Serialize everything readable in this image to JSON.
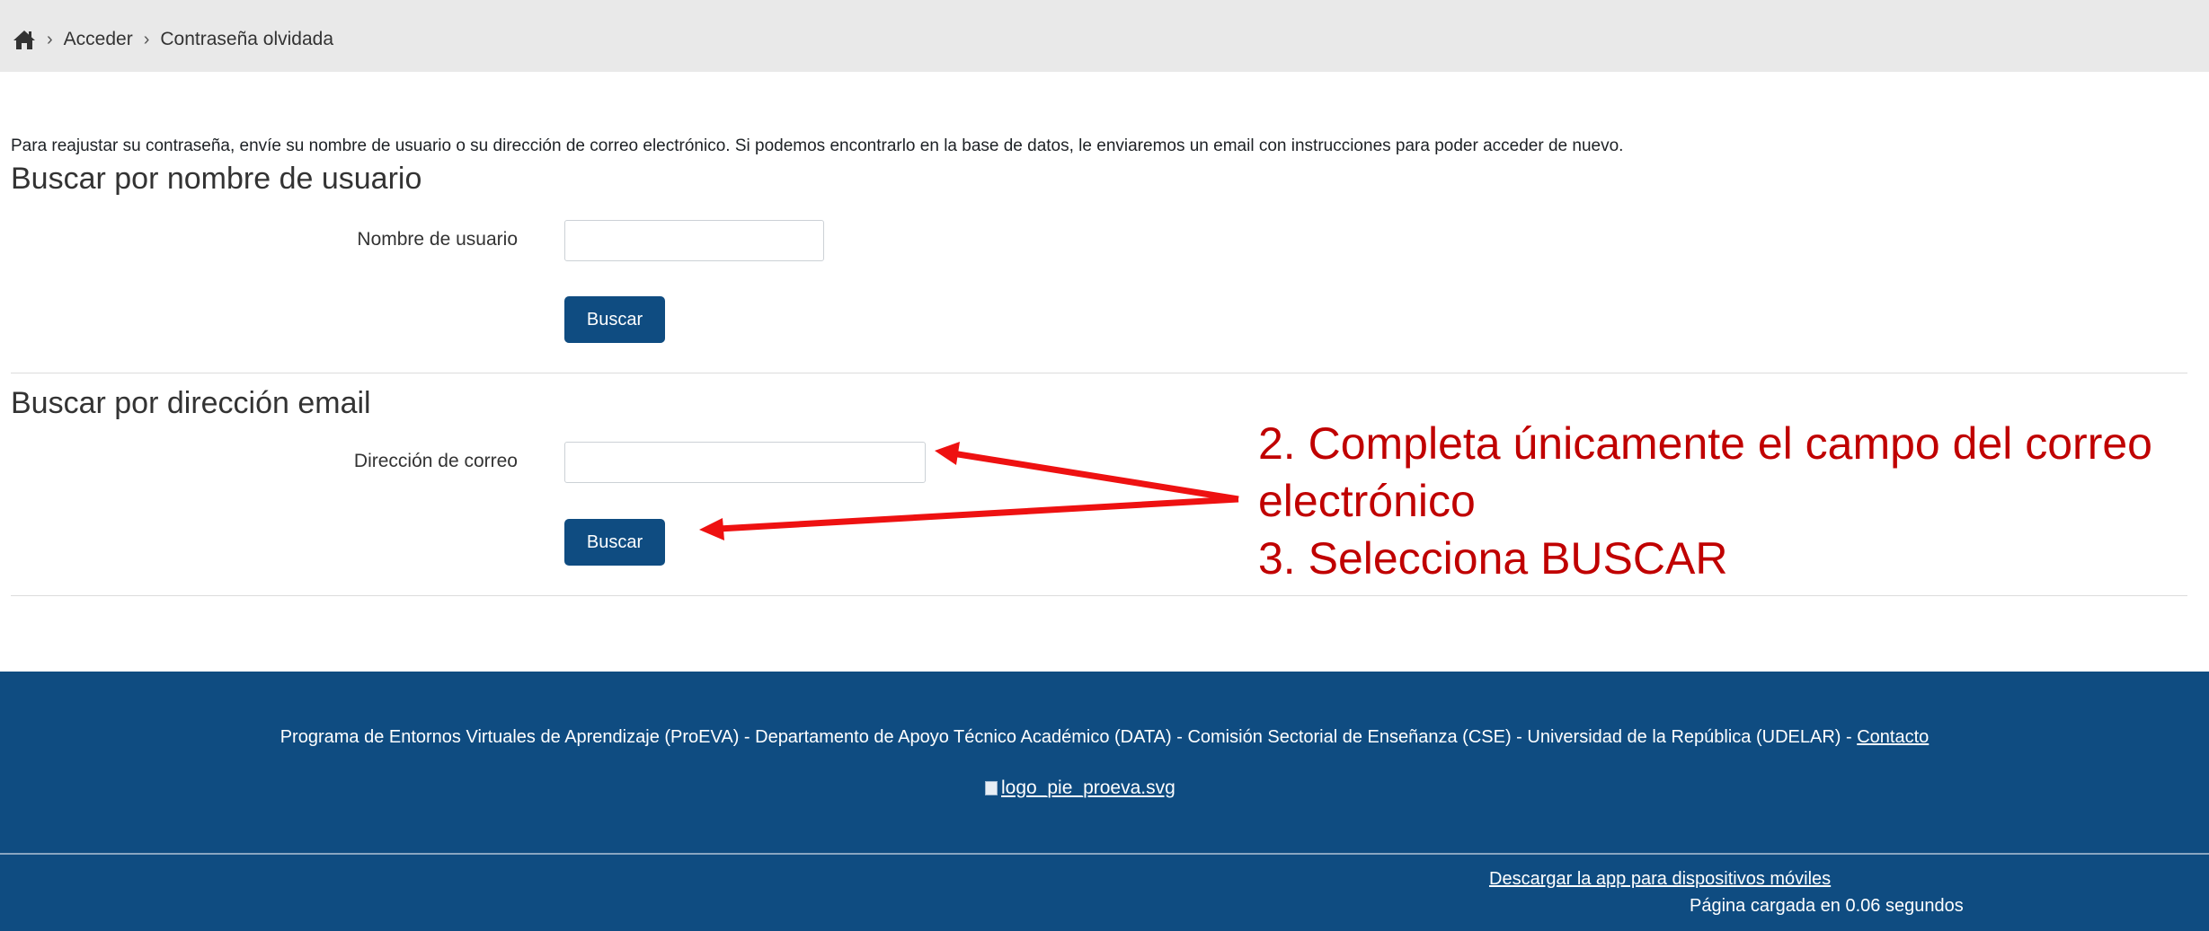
{
  "breadcrumb": {
    "home_icon": "home-icon",
    "items": [
      "Acceder",
      "Contraseña olvidada"
    ],
    "separator": "›"
  },
  "intro_text": "Para reajustar su contraseña, envíe su nombre de usuario o su dirección de correo electrónico. Si podemos encontrarlo en la base de datos, le enviaremos un email con instrucciones para poder acceder de nuevo.",
  "username_section": {
    "heading": "Buscar por nombre de usuario",
    "label": "Nombre de usuario",
    "value": "",
    "button": "Buscar"
  },
  "email_section": {
    "heading": "Buscar por dirección email",
    "label": "Dirección de correo",
    "value": "",
    "button": "Buscar"
  },
  "annotation": {
    "line1": "2. Completa únicamente el campo del correo",
    "line2": "electrónico",
    "line3": "3. Selecciona BUSCAR",
    "color": "#c00000"
  },
  "footer": {
    "text": "Programa de Entornos Virtuales de Aprendizaje (ProEVA) - Departamento de Apoyo Técnico Académico (DATA) - Comisión Sectorial de Enseñanza (CSE) - Universidad de la República (UDELAR) - ",
    "contact_link": "Contacto",
    "logo_alt": "logo_pie_proeva.svg",
    "app_link": "Descargar la app para dispositivos móviles",
    "load_time": "Página cargada en 0.06 segundos",
    "background": "#0f4c81"
  },
  "colors": {
    "button": "#0f4c81",
    "topbar": "#e9e9e9",
    "arrow": "#ee1111"
  }
}
